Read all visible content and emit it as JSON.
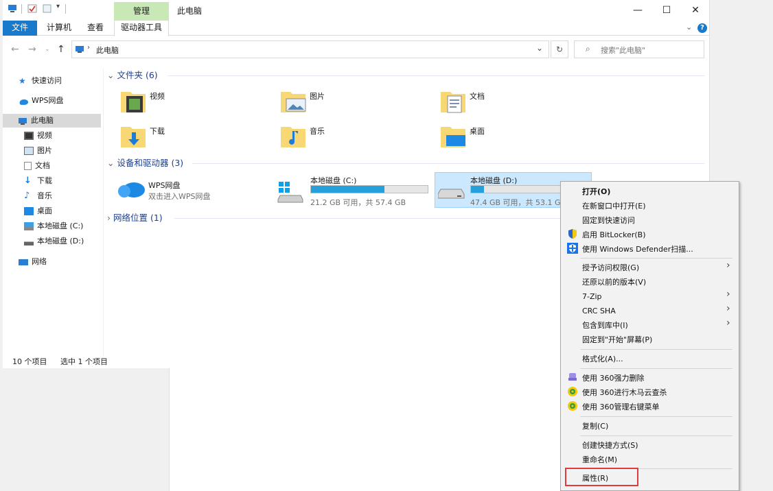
{
  "window": {
    "title": "此电脑",
    "manage_tab": "管理",
    "minimize": "—",
    "maximize": "☐",
    "close": "✕"
  },
  "ribbon": {
    "file": "文件",
    "computer": "计算机",
    "view": "查看",
    "drive_tools": "驱动器工具"
  },
  "address": {
    "path": "此电脑",
    "search_placeholder": "搜索\"此电脑\""
  },
  "nav": {
    "quick_access": "快速访问",
    "wps": "WPS网盘",
    "this_pc": "此电脑",
    "children": [
      "视频",
      "图片",
      "文档",
      "下载",
      "音乐",
      "桌面",
      "本地磁盘 (C:)",
      "本地磁盘 (D:)"
    ],
    "network": "网络"
  },
  "status": {
    "items": "10 个项目",
    "selected": "选中 1 个项目"
  },
  "folders_section": "文件夹 (6)",
  "folders": [
    "视频",
    "图片",
    "文档",
    "下载",
    "音乐",
    "桌面"
  ],
  "devices_section": "设备和驱动器 (3)",
  "wps_drive": {
    "name": "WPS网盘",
    "sub": "双击进入WPS网盘"
  },
  "drives": [
    {
      "name": "本地磁盘 (C:)",
      "free": "21.2 GB 可用，共 57.4 GB",
      "used_fraction": 0.63
    },
    {
      "name": "本地磁盘 (D:)",
      "free": "47.4 GB 可用，共 53.1 GB",
      "used_fraction": 0.11
    }
  ],
  "network_section": "网络位置 (1)",
  "menu": {
    "open": "打开(O)",
    "open_new": "在新窗口中打开(E)",
    "pin_quick": "固定到快速访问",
    "bitlocker": "启用 BitLocker(B)",
    "defender": "使用 Windows Defender扫描...",
    "grant": "授予访问权限(G)",
    "restore": "还原以前的版本(V)",
    "zip": "7-Zip",
    "crc": "CRC SHA",
    "library": "包含到库中(I)",
    "pin_start": "固定到\"开始\"屏幕(P)",
    "format": "格式化(A)...",
    "del360": "使用 360强力删除",
    "scan360": "使用 360进行木马云查杀",
    "manage360": "使用 360管理右键菜单",
    "copy": "复制(C)",
    "shortcut": "创建快捷方式(S)",
    "rename": "重命名(M)",
    "properties": "属性(R)"
  },
  "colors": {
    "accent": "#1979ca",
    "manage_tab": "#c8e9b5",
    "bar_fill": "#26a0da",
    "highlight_box": "#e03a3a"
  }
}
